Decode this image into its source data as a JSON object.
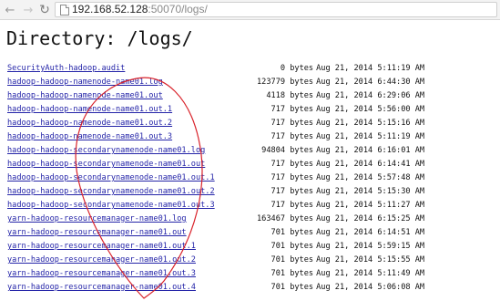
{
  "browser": {
    "back_glyph": "←",
    "forward_glyph": "→",
    "reload_glyph": "↻",
    "url_host": "192.168.52.128",
    "url_path": ":50070/logs/"
  },
  "page": {
    "heading": "Directory: /logs/"
  },
  "files": [
    {
      "name": "SecurityAuth-hadoop.audit",
      "size": "0 bytes",
      "date": "Aug 21, 2014 5:11:19 AM"
    },
    {
      "name": "hadoop-hadoop-namenode-name01.log",
      "size": "123779 bytes",
      "date": "Aug 21, 2014 6:44:30 AM"
    },
    {
      "name": "hadoop-hadoop-namenode-name01.out",
      "size": "4118 bytes",
      "date": "Aug 21, 2014 6:29:06 AM"
    },
    {
      "name": "hadoop-hadoop-namenode-name01.out.1",
      "size": "717 bytes",
      "date": "Aug 21, 2014 5:56:00 AM"
    },
    {
      "name": "hadoop-hadoop-namenode-name01.out.2",
      "size": "717 bytes",
      "date": "Aug 21, 2014 5:15:16 AM"
    },
    {
      "name": "hadoop-hadoop-namenode-name01.out.3",
      "size": "717 bytes",
      "date": "Aug 21, 2014 5:11:19 AM"
    },
    {
      "name": "hadoop-hadoop-secondarynamenode-name01.log",
      "size": "94804 bytes",
      "date": "Aug 21, 2014 6:16:01 AM"
    },
    {
      "name": "hadoop-hadoop-secondarynamenode-name01.out",
      "size": "717 bytes",
      "date": "Aug 21, 2014 6:14:41 AM"
    },
    {
      "name": "hadoop-hadoop-secondarynamenode-name01.out.1",
      "size": "717 bytes",
      "date": "Aug 21, 2014 5:57:48 AM"
    },
    {
      "name": "hadoop-hadoop-secondarynamenode-name01.out.2",
      "size": "717 bytes",
      "date": "Aug 21, 2014 5:15:30 AM"
    },
    {
      "name": "hadoop-hadoop-secondarynamenode-name01.out.3",
      "size": "717 bytes",
      "date": "Aug 21, 2014 5:11:27 AM"
    },
    {
      "name": "yarn-hadoop-resourcemanager-name01.log",
      "size": "163467 bytes",
      "date": "Aug 21, 2014 6:15:25 AM"
    },
    {
      "name": "yarn-hadoop-resourcemanager-name01.out",
      "size": "701 bytes",
      "date": "Aug 21, 2014 6:14:51 AM"
    },
    {
      "name": "yarn-hadoop-resourcemanager-name01.out.1",
      "size": "701 bytes",
      "date": "Aug 21, 2014 5:59:15 AM"
    },
    {
      "name": "yarn-hadoop-resourcemanager-name01.out.2",
      "size": "701 bytes",
      "date": "Aug 21, 2014 5:15:55 AM"
    },
    {
      "name": "yarn-hadoop-resourcemanager-name01.out.3",
      "size": "701 bytes",
      "date": "Aug 21, 2014 5:11:49 AM"
    },
    {
      "name": "yarn-hadoop-resourcemanager-name01.out.4",
      "size": "701 bytes",
      "date": "Aug 21, 2014 5:06:08 AM"
    }
  ],
  "annotation": {
    "color": "#d9222a",
    "shape": "ellipse-freehand"
  }
}
